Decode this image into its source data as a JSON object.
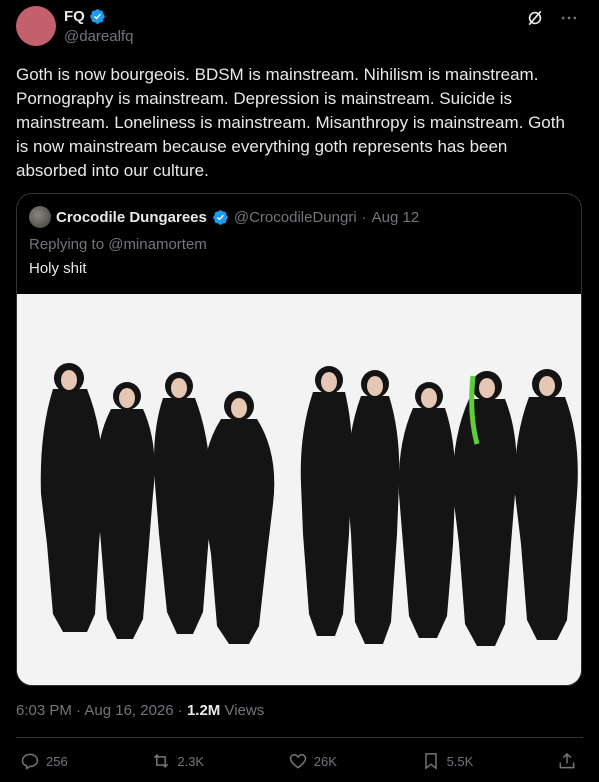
{
  "author": {
    "name": "FQ",
    "handle": "@darealfq"
  },
  "tweet": {
    "text": "Goth is now bourgeois. BDSM is mainstream. Nihilism is mainstream. Pornography is mainstream. Depression is mainstream. Suicide is mainstream. Loneliness is mainstream. Misanthropy is mainstream. Goth is now mainstream because everything goth represents has been absorbed into our culture."
  },
  "quoted": {
    "name": "Crocodile Dungarees",
    "handle": "@CrocodileDungri",
    "separator": "·",
    "date": "Aug 12",
    "reply_to": "Replying to @minamortem",
    "text": "Holy shit"
  },
  "meta": {
    "time_date": "6:03 PM · Aug 16, 2026 · ",
    "views_count": "1.2M",
    "views_label": " Views"
  },
  "actions": {
    "replies": "256",
    "reposts": "2.3K",
    "likes": "26K",
    "bookmarks": "5.5K"
  },
  "colors": {
    "accent": "#1d9bf0",
    "muted": "#71767b",
    "text": "#e7e9ea",
    "avatar": "#c4606b"
  },
  "icons": [
    "verified-badge-icon",
    "grok-icon",
    "more-icon",
    "reply-icon",
    "repost-icon",
    "like-icon",
    "bookmark-icon",
    "share-icon"
  ]
}
